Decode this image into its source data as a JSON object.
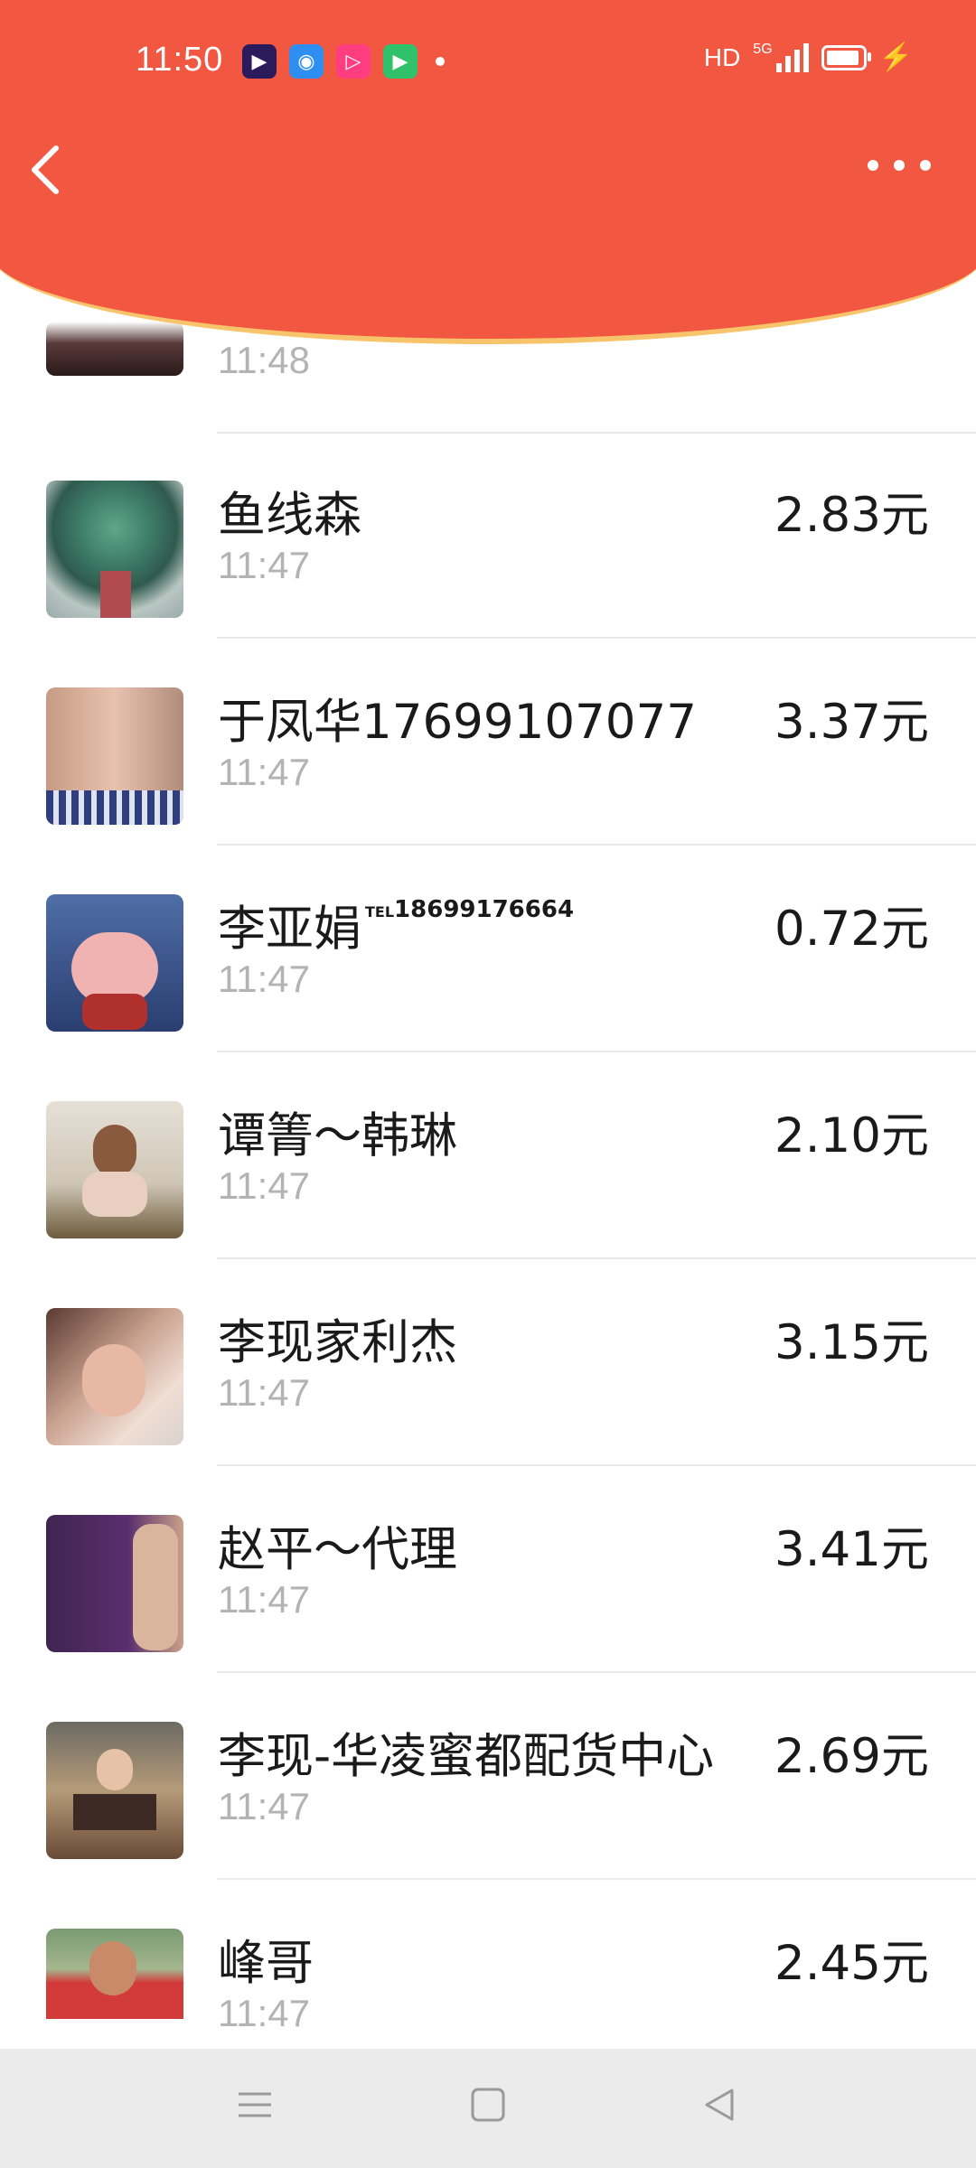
{
  "status_bar": {
    "time": "11:50",
    "hd": "HD",
    "network": "5G",
    "app_icons": [
      "video-app-icon",
      "browser-app-icon",
      "media-app-icon",
      "player-app-icon"
    ]
  },
  "nav": {
    "back_icon": "chevron-left-icon",
    "more_icon": "more-dots-icon"
  },
  "partial_row": {
    "time": "11:48"
  },
  "rows": [
    {
      "name": "鱼线森",
      "time": "11:47",
      "amount": "2.83元",
      "avatar": "flowers"
    },
    {
      "name": "于凤华17699107077",
      "time": "11:47",
      "amount": "3.37元",
      "avatar": "kids"
    },
    {
      "name": "李亚娟",
      "name_suffix_tel": "TEL",
      "name_suffix": "18699176664",
      "time": "11:47",
      "amount": "0.72元",
      "avatar": "pig"
    },
    {
      "name": "谭箐～韩琳",
      "time": "11:47",
      "amount": "2.10元",
      "avatar": "woman-poster"
    },
    {
      "name": "李现家利杰",
      "time": "11:47",
      "amount": "3.15元",
      "avatar": "woman-selfie"
    },
    {
      "name": "赵平～代理",
      "time": "11:47",
      "amount": "3.41元",
      "avatar": "purple-poster"
    },
    {
      "name": "李现-华凌蜜都配货中心",
      "time": "11:47",
      "amount": "2.69元",
      "avatar": "shop"
    },
    {
      "name": "峰哥",
      "time": "11:47",
      "amount": "2.45元",
      "avatar": "man-red"
    }
  ],
  "colors": {
    "header": "#F25742",
    "header_border": "#F7C36B",
    "time_gray": "#b3b3b3"
  },
  "system_nav": [
    "menu-icon",
    "home-square-icon",
    "back-triangle-icon"
  ]
}
